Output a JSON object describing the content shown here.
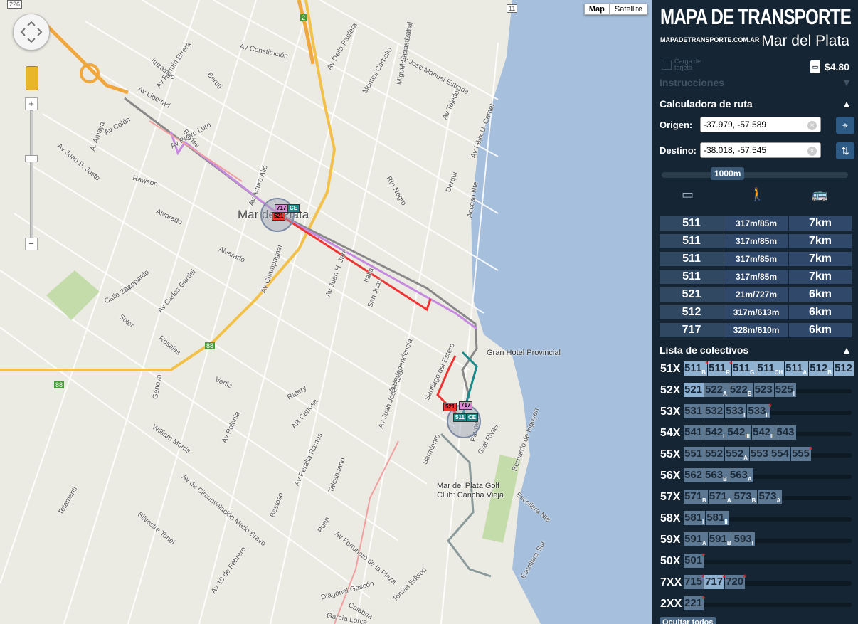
{
  "map": {
    "map_types": [
      "Map",
      "Satellite"
    ],
    "active_map_type": "Map",
    "controls": {
      "pan_icon": "pan-control-icon",
      "pegman_icon": "pegman-icon",
      "zoom_in": "+",
      "zoom_out": "−"
    },
    "city_label": "Mar del Plata",
    "street_labels": [
      "Av Constitución",
      "Av Della Paolera",
      "Av José Manuel Estrada",
      "Alfonsina Storni",
      "Miguel Sagastizabal",
      "Montes Carballo",
      "Av Tejedor",
      "Av Félix U. Camet",
      "Av Libertad",
      "Av Fermín Errera",
      "Beruti",
      "Ituzaingó",
      "Av Colón",
      "Av Pedro Luro",
      "Bayles",
      "A. Amaya",
      "Av Juan B. Justo",
      "Rawson",
      "Alvarado",
      "Av Arturo Alió",
      "Río Negro",
      "Derqui",
      "Acceso Nte",
      "Av Champagnat",
      "Av Juan H. Jara",
      "Italia",
      "San Juan",
      "Av Independencia",
      "Santiago del Estero",
      "Sarmiento",
      "Alvarado",
      "Calle 234",
      "Azopardo",
      "Soler",
      "Av Carlos Gardel",
      "Rosales",
      "Vertiz",
      "Génova",
      "Av Polonia",
      "William Morris",
      "Tetamanti",
      "Av de Circunvalación Mario Bravo",
      "Silvestre Tohel",
      "AR Canosa",
      "Av Peralta Ramos",
      "Talcahuano",
      "Av Juan José Paso",
      "Bestoso",
      "Puan",
      "Av Fortunato de la Plaza",
      "Diagonal Gascón",
      "Tomás Edison",
      "Calabria",
      "García Lorca",
      "Av 10 de Febrero",
      "Bernardo de Irigoyen",
      "Gral Rivas",
      "Paunero",
      "Escollera Nte",
      "Escollera Sur",
      "Ratery"
    ],
    "poi": [
      "Gran Hotel Provincial",
      "Mar del Plata Golf Club: Cancha Vieja"
    ],
    "shields": [
      "226",
      "2",
      "11",
      "88",
      "88"
    ],
    "markers": {
      "origin_badges": [
        "717",
        "CE",
        "521"
      ],
      "destination_badges": [
        "521",
        "717",
        "511",
        "CE"
      ]
    }
  },
  "panel": {
    "brand": "MAPA DE TRANSPORTE",
    "brand_url": "MAPADETRANSPORTE.COM.AR",
    "city": "Mar del Plata",
    "carga_label": "Carga de tarjeta",
    "price": "$4.80",
    "instrucciones": {
      "title": "Instrucciones",
      "icon": "triangle-down-icon"
    },
    "calculadora": {
      "title": "Calculadora de ruta",
      "origen_label": "Origen:",
      "origen_value": "-37.979, -57.589",
      "destino_label": "Destino:",
      "destino_value": "-38.018, -57.545",
      "slider_value": "1000m",
      "column_icons": [
        "bus-stop-sign-icon",
        "walking-person-icon",
        "bus-icon"
      ],
      "routes": [
        {
          "line": "511",
          "walk": "317m/85m",
          "dist": "7km"
        },
        {
          "line": "511",
          "walk": "317m/85m",
          "dist": "7km"
        },
        {
          "line": "511",
          "walk": "317m/85m",
          "dist": "7km"
        },
        {
          "line": "511",
          "walk": "317m/85m",
          "dist": "7km"
        },
        {
          "line": "521",
          "walk": "21m/727m",
          "dist": "6km"
        },
        {
          "line": "512",
          "walk": "317m/613m",
          "dist": "6km"
        },
        {
          "line": "717",
          "walk": "328m/610m",
          "dist": "6km"
        }
      ]
    },
    "lista": {
      "title": "Lista de colectivos",
      "groups": [
        {
          "label": "51X",
          "items": [
            {
              "n": "511",
              "s": "B",
              "star": true,
              "hi": true
            },
            {
              "n": "511",
              "s": "R",
              "star": true,
              "hi": true
            },
            {
              "n": "511",
              "s": "G",
              "hi": true
            },
            {
              "n": "511",
              "s": "CH",
              "hi": true
            },
            {
              "n": "511",
              "s": "A",
              "hi": true
            },
            {
              "n": "512",
              "s": "B",
              "hi": true
            },
            {
              "n": "512",
              "s": "",
              "hi": true
            }
          ]
        },
        {
          "label": "52X",
          "items": [
            {
              "n": "521",
              "s": "",
              "hi": true
            },
            {
              "n": "522",
              "s": "A"
            },
            {
              "n": "522",
              "s": "B"
            },
            {
              "n": "523",
              "s": ""
            },
            {
              "n": "525",
              "s": "I"
            }
          ]
        },
        {
          "label": "53X",
          "items": [
            {
              "n": "531",
              "s": ""
            },
            {
              "n": "532",
              "s": ""
            },
            {
              "n": "533",
              "s": "I"
            },
            {
              "n": "533",
              "s": "II",
              "star": true
            }
          ]
        },
        {
          "label": "54X",
          "items": [
            {
              "n": "541",
              "s": ""
            },
            {
              "n": "542",
              "s": "I"
            },
            {
              "n": "542",
              "s": "III"
            },
            {
              "n": "542",
              "s": "II"
            },
            {
              "n": "543",
              "s": ""
            }
          ]
        },
        {
          "label": "55X",
          "items": [
            {
              "n": "551",
              "s": ""
            },
            {
              "n": "552",
              "s": ""
            },
            {
              "n": "552",
              "s": "A"
            },
            {
              "n": "553",
              "s": ""
            },
            {
              "n": "554",
              "s": ""
            },
            {
              "n": "555",
              "s": "",
              "star": true
            }
          ]
        },
        {
          "label": "56X",
          "items": [
            {
              "n": "562",
              "s": ""
            },
            {
              "n": "563",
              "s": "B"
            },
            {
              "n": "563",
              "s": "A"
            }
          ]
        },
        {
          "label": "57X",
          "items": [
            {
              "n": "571",
              "s": "B"
            },
            {
              "n": "571",
              "s": "A"
            },
            {
              "n": "573",
              "s": "B"
            },
            {
              "n": "573",
              "s": "A"
            }
          ]
        },
        {
          "label": "58X",
          "items": [
            {
              "n": "581",
              "s": "I"
            },
            {
              "n": "581",
              "s": "II"
            }
          ]
        },
        {
          "label": "59X",
          "items": [
            {
              "n": "591",
              "s": "A"
            },
            {
              "n": "591",
              "s": "B"
            },
            {
              "n": "593",
              "s": "I"
            }
          ]
        },
        {
          "label": "50X",
          "items": [
            {
              "n": "501",
              "s": "",
              "star": true
            }
          ]
        },
        {
          "label": "7XX",
          "items": [
            {
              "n": "715",
              "s": "",
              "star": true
            },
            {
              "n": "717",
              "s": "",
              "star": true,
              "hi": true
            },
            {
              "n": "720",
              "s": "",
              "star": true
            }
          ]
        },
        {
          "label": "2XX",
          "items": [
            {
              "n": "221",
              "s": "",
              "star": true
            }
          ]
        }
      ],
      "ocultar_label": "Ocultar todos"
    }
  }
}
